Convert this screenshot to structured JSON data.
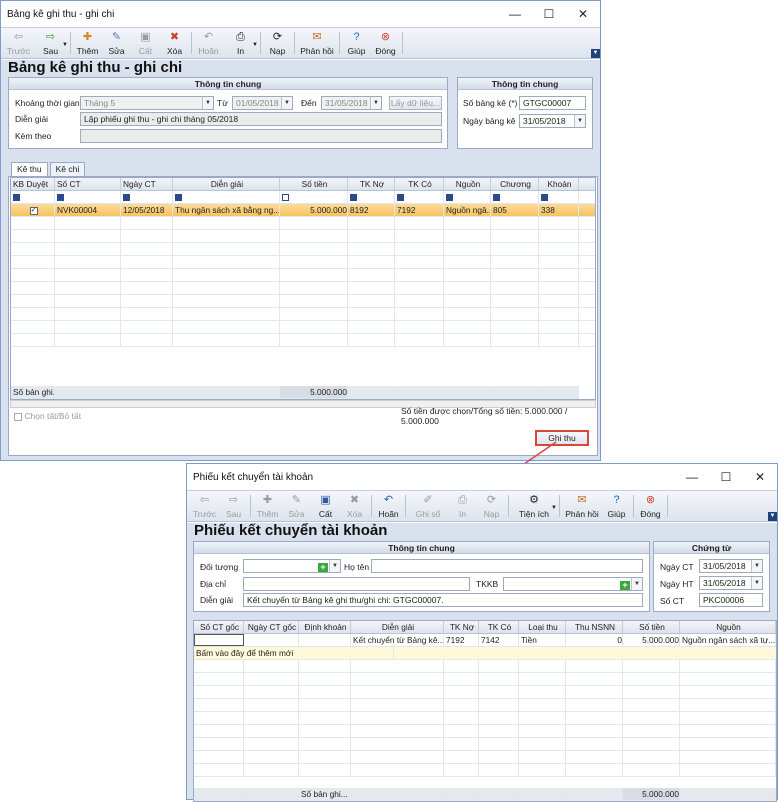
{
  "w1": {
    "title": "Bảng kê ghi thu - ghi chi",
    "toolbar": [
      {
        "label": "Trước",
        "icon": "arrow-left-icon",
        "dis": true
      },
      {
        "label": "Sau",
        "icon": "arrow-right-icon",
        "dis": false
      },
      {
        "label": "Thêm",
        "icon": "add-icon",
        "dis": false
      },
      {
        "label": "Sửa",
        "icon": "edit-icon",
        "dis": false
      },
      {
        "label": "Cất",
        "icon": "save-icon",
        "dis": true
      },
      {
        "label": "Xóa",
        "icon": "delete-icon",
        "dis": false
      },
      {
        "label": "Hoãn",
        "icon": "undo-icon",
        "dis": true
      },
      {
        "label": "In",
        "icon": "print-icon",
        "dis": false
      },
      {
        "label": "Nạp",
        "icon": "refresh-icon",
        "dis": false
      },
      {
        "label": "Phản hồi",
        "icon": "feedback-icon",
        "dis": false
      },
      {
        "label": "Giúp",
        "icon": "help-icon",
        "dis": false
      },
      {
        "label": "Đóng",
        "icon": "close-icon",
        "dis": false
      }
    ],
    "form_title": "Bảng kê ghi thu - ghi chi",
    "general": {
      "header": "Thông tin chung",
      "period_label": "Khoảng thời gian",
      "period_value": "Tháng 5",
      "from_label": "Từ",
      "from_value": "01/05/2018",
      "to_label": "Đến",
      "to_value": "31/05/2018",
      "get_data_label": "Lấy dữ liệu...",
      "desc_label": "Diễn giải",
      "desc_value": "Lập phiếu ghi thu - ghi chi  tháng 05/2018",
      "attach_label": "Kèm theo",
      "attach_value": ""
    },
    "side": {
      "header": "Thông tin chung",
      "no_label": "Số bảng kê (*)",
      "no_value": "GTGC00007",
      "date_label": "Ngày bảng kê",
      "date_value": "31/05/2018"
    },
    "tabs": [
      "Kê thu",
      "Kê chi"
    ],
    "columns": [
      "KB Duyệt",
      "Số CT",
      "Ngày CT",
      "Diễn giải",
      "Số tiền",
      "TK Nợ",
      "TK Có",
      "Nguồn",
      "Chương",
      "Khoản"
    ],
    "rows": [
      {
        "kb": "✓",
        "so_ct": "NVK00004",
        "ngay": "12/05/2018",
        "dien_giai": "Thu ngân sách xã bằng ng...",
        "so_tien": "5.000.000",
        "tk_no": "8192",
        "tk_co": "7192",
        "nguon": "Nguồn ngâ...",
        "chuong": "805",
        "khoan": "338"
      }
    ],
    "footer": {
      "count": "Số bản ghi...",
      "total": "5.000.000"
    },
    "select_all": "Chọn tất/Bỏ tất",
    "summary": "Số tiền được chọn/Tổng số tiền: 5.000.000  / 5.000.000",
    "ghi_thu": "Ghi thu"
  },
  "w2": {
    "title": "Phiếu kết chuyển tài khoản",
    "toolbar": [
      {
        "label": "Trước",
        "icon": "arrow-left-icon",
        "dis": true
      },
      {
        "label": "Sau",
        "icon": "arrow-right-icon",
        "dis": true
      },
      {
        "label": "Thêm",
        "icon": "add-icon",
        "dis": true
      },
      {
        "label": "Sửa",
        "icon": "edit-icon",
        "dis": true
      },
      {
        "label": "Cất",
        "icon": "save-icon",
        "dis": false
      },
      {
        "label": "Xóa",
        "icon": "delete-icon",
        "dis": true
      },
      {
        "label": "Hoãn",
        "icon": "undo-icon",
        "dis": false
      },
      {
        "label": "Ghi sổ",
        "icon": "post-icon",
        "dis": true
      },
      {
        "label": "In",
        "icon": "print-icon",
        "dis": true
      },
      {
        "label": "Nạp",
        "icon": "refresh-icon",
        "dis": true
      },
      {
        "label": "Tiện ích",
        "icon": "tools-icon",
        "dis": false
      },
      {
        "label": "Phản hồi",
        "icon": "feedback-icon",
        "dis": false
      },
      {
        "label": "Giúp",
        "icon": "help-icon",
        "dis": false
      },
      {
        "label": "Đóng",
        "icon": "close-icon",
        "dis": false
      }
    ],
    "form_title": "Phiếu kết chuyển tài khoản",
    "general": {
      "header": "Thông tin chung",
      "obj_label": "Đối tượng",
      "name_label": "Họ tên",
      "addr_label": "Địa chỉ",
      "tkkb_label": "TKKB",
      "desc_label": "Diễn giải",
      "desc_value": "Kết chuyển từ Bảng kê ghi thu/ghi chi: GTGC00007."
    },
    "voucher": {
      "header": "Chứng từ",
      "ct_label": "Ngày CT",
      "ct_value": "31/05/2018",
      "ht_label": "Ngày HT",
      "ht_value": "31/05/2018",
      "no_label": "Số CT",
      "no_value": "PKC00006"
    },
    "columns": [
      "Số CT gốc",
      "Ngày CT gốc",
      "Định khoản",
      "Diễn giải",
      "TK Nợ",
      "TK Có",
      "Loại thu",
      "Thu NSNN",
      "Số tiền",
      "Nguồn"
    ],
    "rows": [
      {
        "so_ct": "",
        "ngay": "",
        "dinh_khoan": "",
        "dien_giai": "Kết chuyển từ Bảng kê...",
        "tk_no": "7192",
        "tk_co": "7142",
        "loai_thu": "Tiền",
        "thu": "0",
        "so_tien": "5.000.000",
        "nguon": "Nguồn ngân sách xã tự..."
      }
    ],
    "new_row": "Bấm vào đây để thêm mới",
    "footer": {
      "count": "Số bản ghi...",
      "total": "5.000.000"
    }
  }
}
